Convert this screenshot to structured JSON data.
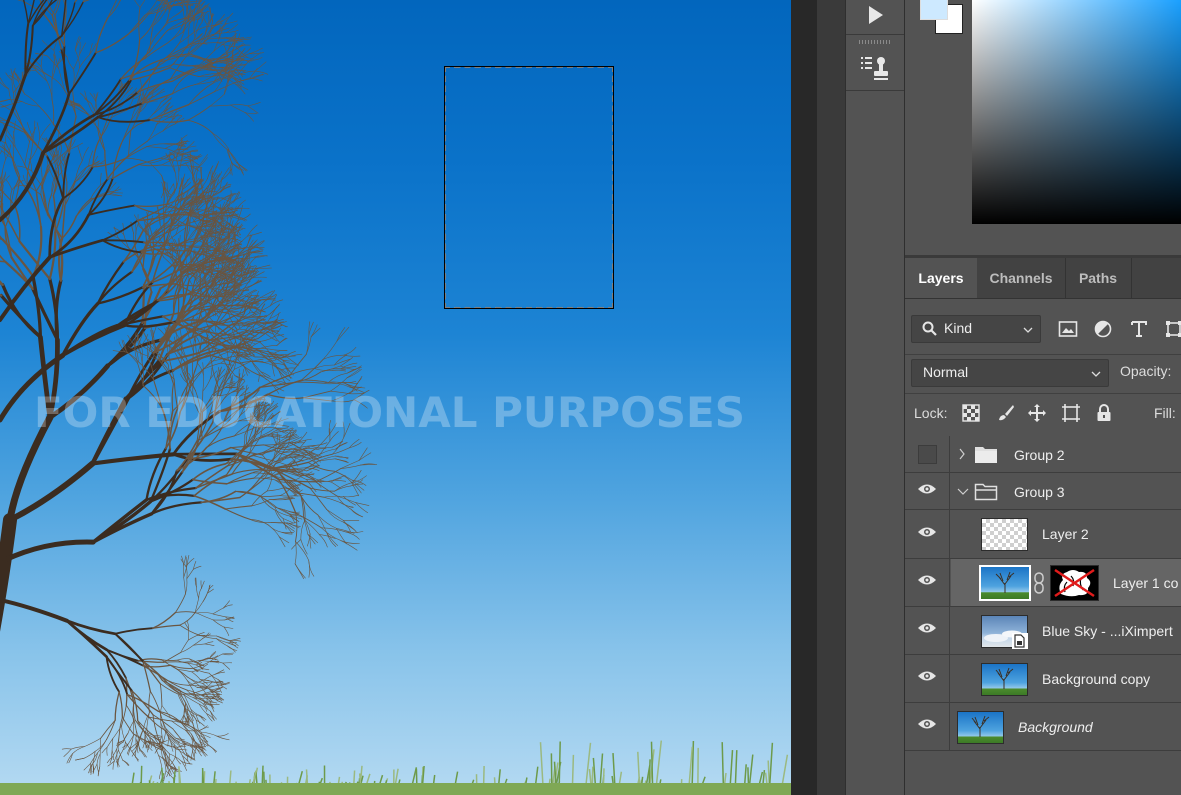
{
  "canvas": {
    "watermark_text": "FOR EDUCATIONAL PURPOSES"
  },
  "toolbar": {
    "icons": [
      "play-icon",
      "clone-source-icon"
    ]
  },
  "color": {
    "foreground": "#cde9ff",
    "background": "#ffffff",
    "picker_hue": "#1aa0ff"
  },
  "tabs": [
    {
      "label": "Layers",
      "active": true
    },
    {
      "label": "Channels",
      "active": false
    },
    {
      "label": "Paths",
      "active": false
    }
  ],
  "filter": {
    "kind_label": "Kind",
    "icons": [
      "image-filter-icon",
      "adjustment-filter-icon",
      "type-filter-icon",
      "shape-filter-icon"
    ]
  },
  "blend": {
    "mode": "Normal",
    "opacity_label": "Opacity:"
  },
  "lock": {
    "label": "Lock:",
    "icons": [
      "lock-transparent-icon",
      "lock-paint-icon",
      "lock-move-icon",
      "lock-artboard-icon",
      "lock-all-icon"
    ],
    "fill_label": "Fill:"
  },
  "layers": [
    {
      "name": "Group 2",
      "type": "group",
      "visible": false,
      "expanded": false
    },
    {
      "name": "Group 3",
      "type": "group",
      "visible": true,
      "expanded": true
    },
    {
      "name": "Layer 2",
      "type": "pixel",
      "visible": true
    },
    {
      "name": "Layer 1 co",
      "type": "pixel-with-mask",
      "visible": true,
      "selected": true
    },
    {
      "name": "Blue Sky - ...iXimpert",
      "type": "smart-object",
      "visible": true
    },
    {
      "name": "Background copy",
      "type": "pixel",
      "visible": true
    },
    {
      "name": "Background",
      "type": "background",
      "visible": true
    }
  ]
}
